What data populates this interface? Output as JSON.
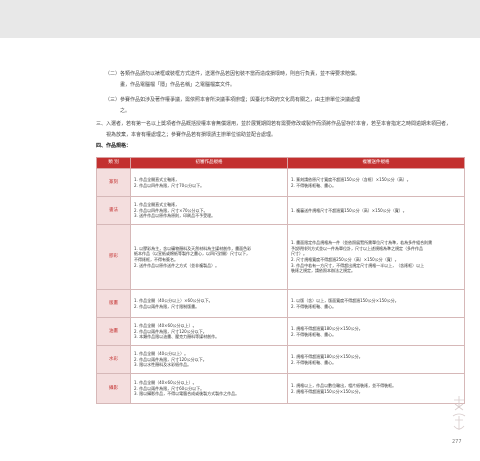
{
  "intro": {
    "line1": "（二）各類作品請勿以裱框或裝框方式送件，送選作品若因包裝不當而造成損壞時，則自行負責，並不得要求賠償。",
    "line2": "　　　畫，作品電腦檔「隱」作品名稱」之電腦檔案文件。",
    "line3": "（三）參賽作品如涉及著作權爭議，需依照本會所決議事項辦理；與臺北市政府文化局有關之，由主辦單位決議處理",
    "line4": "　　　之。",
    "line5": "三、入選者，若有第一名以上獎項者作品概括授權本會無償運用，並於展覽期間若有需要修改或製作而須將作品留存於本會，若至本會指定之時間逾期未領回者，",
    "line6": "　　視為放棄，本會有權處理之；參賽作品若有損壞請主辦單位協助並配合處理。",
    "heading": "四、作品規格："
  },
  "table": {
    "headers": [
      "類 別",
      "初審作品規格",
      "複審送件規格"
    ],
    "rows": [
      {
        "category": "篆刻",
        "initial": [
          "1. 作品全開直式立軸裱，",
          "2. 作品以四件為限，尺寸70公分以下。"
        ],
        "final": [
          "1. 篆刻請依原尺寸寬度不超過150公分（含框）×150公分（高）。",
          "2. 不得裝裱框軸、畫心。"
        ]
      },
      {
        "category": "書法",
        "initial": [
          "1. 作品全開直式立軸裱，",
          "2. 作品以四件為限，尺寸×70公分以下。",
          "3. 送件作品以原作為原則，印刷品不予受理。"
        ],
        "final": [
          "1. 複審送件規格尺寸不超過寬150公分（高）×150公分（寬）。"
        ]
      },
      {
        "category": "膠彩",
        "initial": [
          "1. 以膠彩為主，含以礦物顏料及天然材料為主媒材創作，畫面色彩",
          "紙本作品（以宣紙或棉紙等製作之畫心，以四尺對開）尺寸以下，",
          "不得裱框，不得有簽名。",
          "2. 送件作品以原作送件之方式（並非複製品）。"
        ],
        "final": [
          "1. 畫面限定作品規格為一件（並依照展覽所需單位尺寸為準，若為多件組合則需",
          "予說明排列方式並以一件為單位計，尺寸以上述規格為準之規定（多件作品",
          "尺寸）。",
          "2. 尺寸規格寬度不得超過250公分（高）×150公分（寬）。",
          "3. 作品中若有一方尺寸，不得超出規定尺寸規格一半以上，（含裱框）以上",
          "裝裱之規定，請依照本辦法之規定。"
        ]
      },
      {
        "category": "版畫",
        "initial": [
          "1. 作品全開（40公分以上）×60公分以下。",
          "2. 作品以兩件為限，尺寸限制版畫。"
        ],
        "final": [
          "1. 以版（含）以上，版面寬度不得超過150公分×150公分。",
          "2. 不得裝裱框軸、畫心。"
        ]
      },
      {
        "category": "油畫",
        "initial": [
          "1. 作品全開（40×60公分以上）。",
          "2. 作品以兩件為限，尺寸120公分以下。",
          "3. 本類作品限以油畫、壓克力顏料等媒材創作。"
        ],
        "final": [
          "1. 規格不得超過寬180公分×150公分。",
          "2. 不得裝裱框軸、畫心。"
        ]
      },
      {
        "category": "水彩",
        "initial": [
          "1. 作品全開（40公分以上）。",
          "2. 作品以兩件為限，尺寸120公分以下。",
          "3. 限以水性顏料及水彩紙作品。"
        ],
        "final": [
          "1. 規格不得超過寬180公分×150公分。",
          "2. 不得裝裱框軸、畫心。"
        ]
      },
      {
        "category": "攝影",
        "initial": [
          "1. 作品全開（40×60公分以上）。",
          "2. 作品以兩件為限，尺寸60公分以下。",
          "3. 限以攝影作品，不得以電腦合成或後製方式製作之作品。"
        ],
        "final": [
          "1. 規格以上，作品以數位輸出，相片紙裝裱，並不得裝框。",
          "2. 規格不得超過寬150公分×150公分。"
        ]
      }
    ]
  },
  "page_number": "277",
  "seal_text": "文化部"
}
